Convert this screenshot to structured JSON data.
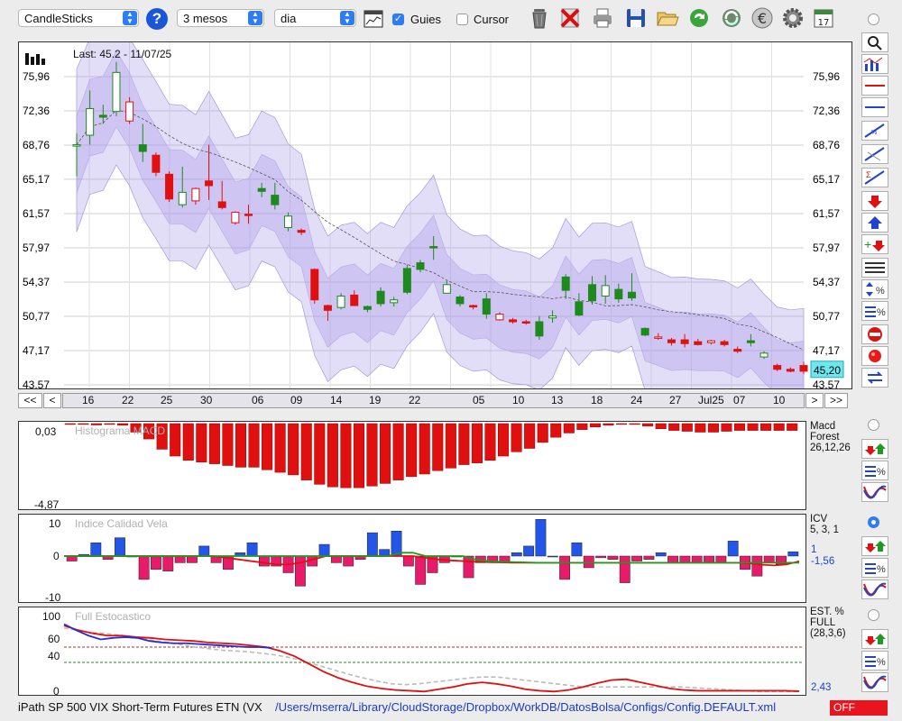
{
  "toolbar": {
    "chart_type": "CandleSticks",
    "period": "3 mesos",
    "interval": "dia",
    "guides_label": "Guies",
    "guides_checked": true,
    "cursor_label": "Cursor",
    "cursor_checked": false,
    "calendar_day": "17"
  },
  "main_chart": {
    "last_label": "Last: 45.2 - 11/07/25",
    "y_ticks": [
      "75,96",
      "72,36",
      "68,76",
      "65,17",
      "61,57",
      "57,97",
      "54,37",
      "50,77",
      "47,17",
      "43,57"
    ],
    "current_value": "45,20",
    "x_ticks": [
      "16",
      "22",
      "25",
      "30",
      "06",
      "09",
      "14",
      "19",
      "22",
      "05",
      "10",
      "13",
      "18",
      "24",
      "27",
      "Jul25",
      "07",
      "10"
    ],
    "nav": {
      "first": "<<",
      "prev": "<",
      "next": ">",
      "last": ">>"
    }
  },
  "macd": {
    "title": "Histograma MACD",
    "y_top": "0,03",
    "y_bottom": "-4,87",
    "label1": "Macd",
    "label2": "Forest",
    "label3": "26,12,26"
  },
  "icv": {
    "title": "Indice Calidad Vela",
    "y_top": "10",
    "y_mid": "0",
    "y_bottom": "-10",
    "label1": "ICV",
    "label2": "5, 3, 1",
    "value1": "1",
    "value2": "-1,56"
  },
  "stoch": {
    "title": "Full Estocastico",
    "y_100": "100",
    "y_60": "60",
    "y_40": "40",
    "y_0": "0",
    "label1": "EST. %",
    "label2": "FULL",
    "label3": "(28,3,6)",
    "value": "2,43"
  },
  "status": {
    "instrument": "iPath SP 500 VIX Short-Term Futures ETN (VX",
    "path": "/Users/mserra/Library/CloudStorage/Dropbox/WorkDB/DatosBolsa/Configs/Config.DEFAULT.xml",
    "state": "OFF"
  },
  "colors": {
    "bull": "#1e8a1e",
    "bear": "#e01010",
    "band": "#a898e8",
    "accent": "#2e7cf6",
    "value_box": "#6ee8f0"
  },
  "chart_data": [
    {
      "type": "candlestick",
      "ylim": [
        43.57,
        77.8
      ],
      "y_ticks": [
        75.96,
        72.36,
        68.76,
        65.17,
        61.57,
        57.97,
        54.37,
        50.77,
        47.17,
        43.57
      ],
      "candles": [
        {
          "o": 68.8,
          "h": 70.0,
          "l": 65.5,
          "c": 68.8,
          "d": "up"
        },
        {
          "o": 69.8,
          "h": 74.5,
          "l": 68.8,
          "c": 72.6,
          "d": "up"
        },
        {
          "o": 71.7,
          "h": 73.0,
          "l": 71.0,
          "c": 71.9,
          "d": "up"
        },
        {
          "o": 72.3,
          "h": 77.5,
          "l": 71.8,
          "c": 76.4,
          "d": "up"
        },
        {
          "o": 73.3,
          "h": 73.8,
          "l": 71.0,
          "c": 71.3,
          "d": "dn"
        },
        {
          "o": 68.8,
          "h": 71.0,
          "l": 67.0,
          "c": 68.1,
          "d": "up"
        },
        {
          "o": 67.7,
          "h": 68.0,
          "l": 65.5,
          "c": 65.9,
          "d": "dn"
        },
        {
          "o": 65.7,
          "h": 66.0,
          "l": 62.8,
          "c": 63.1,
          "d": "dn"
        },
        {
          "o": 63.8,
          "h": 66.5,
          "l": 62.2,
          "c": 62.5,
          "d": "up"
        },
        {
          "o": 64.2,
          "h": 64.3,
          "l": 62.5,
          "c": 62.9,
          "d": "dn"
        },
        {
          "o": 65.0,
          "h": 68.8,
          "l": 63.0,
          "c": 64.5,
          "d": "dn"
        },
        {
          "o": 62.8,
          "h": 65.0,
          "l": 62.0,
          "c": 62.2,
          "d": "dn"
        },
        {
          "o": 61.7,
          "h": 61.8,
          "l": 60.4,
          "c": 60.6,
          "d": "dn"
        },
        {
          "o": 61.5,
          "h": 62.5,
          "l": 60.5,
          "c": 61.4,
          "d": "dn"
        },
        {
          "o": 63.9,
          "h": 64.8,
          "l": 63.3,
          "c": 64.2,
          "d": "up"
        },
        {
          "o": 62.5,
          "h": 64.8,
          "l": 62.0,
          "c": 63.5,
          "d": "up"
        },
        {
          "o": 61.3,
          "h": 61.7,
          "l": 59.7,
          "c": 60.1,
          "d": "up"
        },
        {
          "o": 59.8,
          "h": 60.0,
          "l": 59.3,
          "c": 59.6,
          "d": "dn"
        },
        {
          "o": 55.7,
          "h": 55.8,
          "l": 52.1,
          "c": 52.5,
          "d": "dn"
        },
        {
          "o": 51.9,
          "h": 52.0,
          "l": 50.3,
          "c": 51.4,
          "d": "dn"
        },
        {
          "o": 51.7,
          "h": 53.2,
          "l": 51.5,
          "c": 52.9,
          "d": "up"
        },
        {
          "o": 53.0,
          "h": 53.5,
          "l": 51.9,
          "c": 51.9,
          "d": "dn"
        },
        {
          "o": 51.5,
          "h": 51.9,
          "l": 51.2,
          "c": 51.8,
          "d": "up"
        },
        {
          "o": 52.1,
          "h": 53.8,
          "l": 51.8,
          "c": 53.4,
          "d": "up"
        },
        {
          "o": 52.5,
          "h": 52.8,
          "l": 51.8,
          "c": 52.2,
          "d": "up"
        },
        {
          "o": 53.3,
          "h": 56.2,
          "l": 53.1,
          "c": 55.8,
          "d": "up"
        },
        {
          "o": 55.7,
          "h": 56.7,
          "l": 55.4,
          "c": 56.4,
          "d": "up"
        },
        {
          "o": 58.0,
          "h": 59.2,
          "l": 56.7,
          "c": 58.1,
          "d": "up"
        },
        {
          "o": 54.1,
          "h": 54.5,
          "l": 53.2,
          "c": 53.2,
          "d": "up"
        },
        {
          "o": 52.8,
          "h": 53.0,
          "l": 51.8,
          "c": 52.1,
          "d": "up"
        },
        {
          "o": 51.8,
          "h": 52.0,
          "l": 51.5,
          "c": 51.9,
          "d": "dn"
        },
        {
          "o": 51.0,
          "h": 53.2,
          "l": 50.5,
          "c": 52.6,
          "d": "up"
        },
        {
          "o": 51.0,
          "h": 51.2,
          "l": 50.3,
          "c": 50.4,
          "d": "dn"
        },
        {
          "o": 50.4,
          "h": 50.6,
          "l": 50.0,
          "c": 50.2,
          "d": "dn"
        },
        {
          "o": 50.2,
          "h": 50.4,
          "l": 49.9,
          "c": 50.1,
          "d": "dn"
        },
        {
          "o": 48.7,
          "h": 50.8,
          "l": 48.3,
          "c": 50.2,
          "d": "up"
        },
        {
          "o": 50.6,
          "h": 51.4,
          "l": 50.1,
          "c": 50.8,
          "d": "up"
        },
        {
          "o": 53.5,
          "h": 55.2,
          "l": 52.6,
          "c": 54.9,
          "d": "up"
        },
        {
          "o": 52.3,
          "h": 53.2,
          "l": 50.8,
          "c": 50.9,
          "d": "up"
        },
        {
          "o": 52.4,
          "h": 55.0,
          "l": 52.0,
          "c": 54.1,
          "d": "up"
        },
        {
          "o": 54.0,
          "h": 55.1,
          "l": 52.1,
          "c": 52.9,
          "d": "up"
        },
        {
          "o": 52.6,
          "h": 54.2,
          "l": 52.2,
          "c": 53.6,
          "d": "up"
        },
        {
          "o": 52.7,
          "h": 55.3,
          "l": 52.4,
          "c": 53.3,
          "d": "up"
        },
        {
          "o": 49.5,
          "h": 49.6,
          "l": 48.7,
          "c": 48.8,
          "d": "up"
        },
        {
          "o": 48.6,
          "h": 49.0,
          "l": 48.3,
          "c": 48.6,
          "d": "dn"
        },
        {
          "o": 48.3,
          "h": 48.5,
          "l": 47.7,
          "c": 48.0,
          "d": "dn"
        },
        {
          "o": 47.9,
          "h": 48.9,
          "l": 47.5,
          "c": 48.3,
          "d": "dn"
        },
        {
          "o": 48.1,
          "h": 48.4,
          "l": 47.7,
          "c": 47.8,
          "d": "dn"
        },
        {
          "o": 48.2,
          "h": 48.3,
          "l": 47.8,
          "c": 48.0,
          "d": "dn"
        },
        {
          "o": 48.1,
          "h": 48.3,
          "l": 47.6,
          "c": 47.8,
          "d": "dn"
        },
        {
          "o": 47.3,
          "h": 47.6,
          "l": 46.9,
          "c": 47.1,
          "d": "dn"
        },
        {
          "o": 48.2,
          "h": 48.9,
          "l": 47.6,
          "c": 48.0,
          "d": "up"
        },
        {
          "o": 46.9,
          "h": 47.1,
          "l": 46.3,
          "c": 46.5,
          "d": "up"
        },
        {
          "o": 45.6,
          "h": 45.8,
          "l": 45.0,
          "c": 45.2,
          "d": "dn"
        },
        {
          "o": 45.2,
          "h": 45.4,
          "l": 44.9,
          "c": 45.0,
          "d": "dn"
        },
        {
          "o": 45.6,
          "h": 46.0,
          "l": 44.7,
          "c": 45.0,
          "d": "dn"
        }
      ]
    },
    {
      "type": "bar",
      "ylim": [
        -4.87,
        0.03
      ],
      "values": [
        -0.05,
        -0.05,
        -0.08,
        -0.05,
        -0.1,
        -0.5,
        -0.9,
        -1.5,
        -1.9,
        -2.15,
        -2.25,
        -2.35,
        -2.45,
        -2.55,
        -2.55,
        -2.7,
        -2.85,
        -3.0,
        -3.3,
        -3.55,
        -3.7,
        -3.75,
        -3.75,
        -3.65,
        -3.5,
        -3.3,
        -3.1,
        -2.95,
        -2.75,
        -2.6,
        -2.4,
        -2.3,
        -2.15,
        -1.9,
        -1.65,
        -1.45,
        -1.1,
        -0.8,
        -0.55,
        -0.35,
        -0.2,
        -0.1,
        -0.05,
        -0.05,
        -0.15,
        -0.3,
        -0.4,
        -0.45,
        -0.5,
        -0.5,
        -0.45,
        -0.4,
        -0.4,
        -0.4,
        -0.4,
        -0.4
      ]
    },
    {
      "type": "bar",
      "ylim": [
        -10,
        10
      ],
      "values": [
        -1.5,
        0.5,
        4,
        -1,
        5.5,
        0,
        -7,
        -4,
        -4.5,
        -2,
        -2,
        3,
        -2,
        -4,
        1,
        4,
        -3,
        -3,
        -5,
        -9,
        -3,
        3.5,
        -2,
        -3,
        -1,
        7,
        2,
        7.5,
        -3,
        -8.5,
        -5,
        -2,
        0,
        -6.5,
        -2,
        -2,
        -2,
        1,
        3,
        11,
        0,
        -7,
        4,
        -3.5,
        -0.5,
        -1,
        -8,
        -1.5,
        -1,
        1,
        -2,
        -2,
        -2,
        -2,
        -2,
        4.5,
        -4,
        -6,
        -2,
        -2.5,
        1.3
      ],
      "series": [
        {
          "values": [
            0,
            0,
            0,
            0,
            0,
            0,
            0,
            0,
            0,
            0,
            0,
            0,
            0,
            -0.5,
            -1,
            -1.5,
            -2,
            -2.5,
            -2.5,
            -2,
            -1,
            0,
            0,
            0,
            0,
            0,
            0,
            0,
            0,
            -0.5,
            -1,
            -1.3,
            -1.5,
            -1.7,
            -1.8,
            -1.9,
            -2,
            -2,
            -2,
            -2,
            -2,
            -2,
            -2,
            -2,
            -2,
            -2,
            -2,
            -2,
            -2,
            -2,
            -2,
            -2,
            -2,
            -2,
            -2,
            -2.2,
            -2.6,
            -2.8,
            -2.5,
            -1.56
          ]
        },
        {
          "values": [
            0,
            0,
            0,
            0,
            0,
            0,
            0,
            0,
            0,
            0,
            0,
            0,
            0,
            0,
            0,
            0,
            0,
            0,
            0,
            0,
            0,
            0,
            0,
            0,
            0,
            0,
            0,
            1,
            1,
            0,
            0,
            0,
            0,
            -1,
            -1.5,
            -1.7,
            -1.8,
            -1.9,
            -2,
            -2,
            -2,
            -2,
            -2,
            -2,
            -2,
            -2,
            -2,
            -2,
            -2,
            -2,
            -2,
            -2,
            -2,
            -2,
            -2,
            -2,
            -2,
            -2,
            -2,
            -2
          ]
        }
      ]
    },
    {
      "type": "line",
      "ylim": [
        0,
        100
      ],
      "series": [
        {
          "values": [
            85,
            82,
            79,
            78,
            76,
            74,
            71,
            68,
            66,
            63,
            60,
            58,
            56,
            55,
            54,
            52,
            50,
            47,
            43,
            38,
            33,
            28,
            23,
            19,
            15,
            12,
            11,
            12,
            14,
            16,
            18,
            20,
            21,
            21,
            19,
            17,
            15,
            13,
            11,
            9,
            8,
            8,
            8,
            8,
            8,
            8,
            8,
            8,
            7,
            6,
            5,
            4,
            3,
            2,
            2,
            2,
            2
          ]
        },
        {
          "values": [
            88,
            82,
            78,
            75,
            75,
            73,
            72,
            70,
            69,
            68,
            66,
            65,
            64,
            62,
            60,
            55,
            48,
            38,
            28,
            20,
            14,
            9,
            6,
            4,
            3,
            2,
            5,
            8,
            12,
            14,
            12,
            9,
            5,
            3,
            2,
            4,
            8,
            13,
            17,
            18,
            14,
            10,
            6,
            4,
            3,
            3,
            3,
            3,
            3,
            3,
            3,
            2.43
          ]
        },
        {
          "values": [
            90,
            82,
            75,
            70,
            72,
            73,
            72,
            68,
            66,
            65,
            65,
            64,
            63,
            62,
            61,
            60,
            60,
            59
          ]
        }
      ]
    }
  ]
}
